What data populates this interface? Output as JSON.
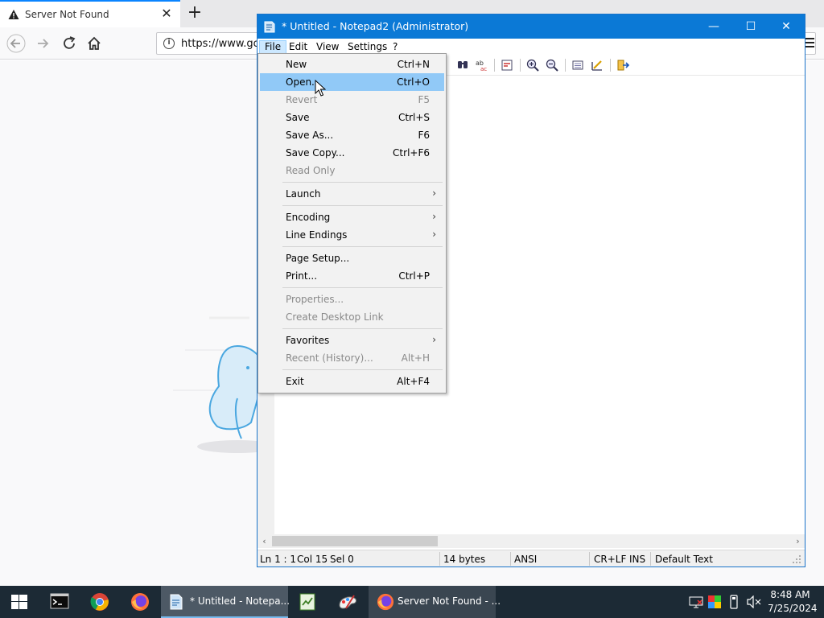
{
  "browser": {
    "tab_title": "Server Not Found",
    "tab_close": "✕",
    "new_tab": "+",
    "url": "https://www.go"
  },
  "notepad": {
    "title": "* Untitled - Notepad2 (Administrator)",
    "window_buttons": {
      "minimize": "—",
      "maximize": "☐",
      "close": "✕"
    },
    "menu": {
      "file": "File",
      "edit": "Edit",
      "view": "View",
      "settings": "Settings",
      "help": "?"
    },
    "status": {
      "position": "Ln 1 : 1",
      "column": "Col 15",
      "selection": "Sel 0",
      "size": "14 bytes",
      "encoding": "ANSI",
      "line_endings": "CR+LF",
      "mode": "INS",
      "scheme": "Default Text"
    }
  },
  "file_menu": {
    "items": [
      {
        "label": "New",
        "shortcut": "Ctrl+N",
        "disabled": false
      },
      {
        "label": "Open...",
        "shortcut": "Ctrl+O",
        "disabled": false,
        "highlighted": true
      },
      {
        "label": "Revert",
        "shortcut": "F5",
        "disabled": true
      },
      {
        "label": "Save",
        "shortcut": "Ctrl+S",
        "disabled": false
      },
      {
        "label": "Save As...",
        "shortcut": "F6",
        "disabled": false
      },
      {
        "label": "Save Copy...",
        "shortcut": "Ctrl+F6",
        "disabled": false
      },
      {
        "label": "Read Only",
        "shortcut": "",
        "disabled": true
      },
      {
        "label": "Launch",
        "submenu": true
      },
      {
        "label": "Encoding",
        "submenu": true
      },
      {
        "label": "Line Endings",
        "submenu": true
      },
      {
        "label": "Page Setup...",
        "shortcut": "",
        "disabled": false
      },
      {
        "label": "Print...",
        "shortcut": "Ctrl+P",
        "disabled": false
      },
      {
        "label": "Properties...",
        "shortcut": "",
        "disabled": true
      },
      {
        "label": "Create Desktop Link",
        "shortcut": "",
        "disabled": true
      },
      {
        "label": "Favorites",
        "submenu": true
      },
      {
        "label": "Recent (History)...",
        "shortcut": "Alt+H",
        "disabled": true
      },
      {
        "label": "Exit",
        "shortcut": "Alt+F4",
        "disabled": false
      }
    ],
    "submenu_arrow": "›"
  },
  "taskbar": {
    "notepad_label": "* Untitled - Notepa...",
    "firefox_label": "Server Not Found - ...",
    "time": "8:48 AM",
    "date": "7/25/2024"
  },
  "colors": {
    "titlebar": "#0b79d6",
    "menu_highlight": "#91c9f7",
    "taskbar": "#1c2a35"
  }
}
